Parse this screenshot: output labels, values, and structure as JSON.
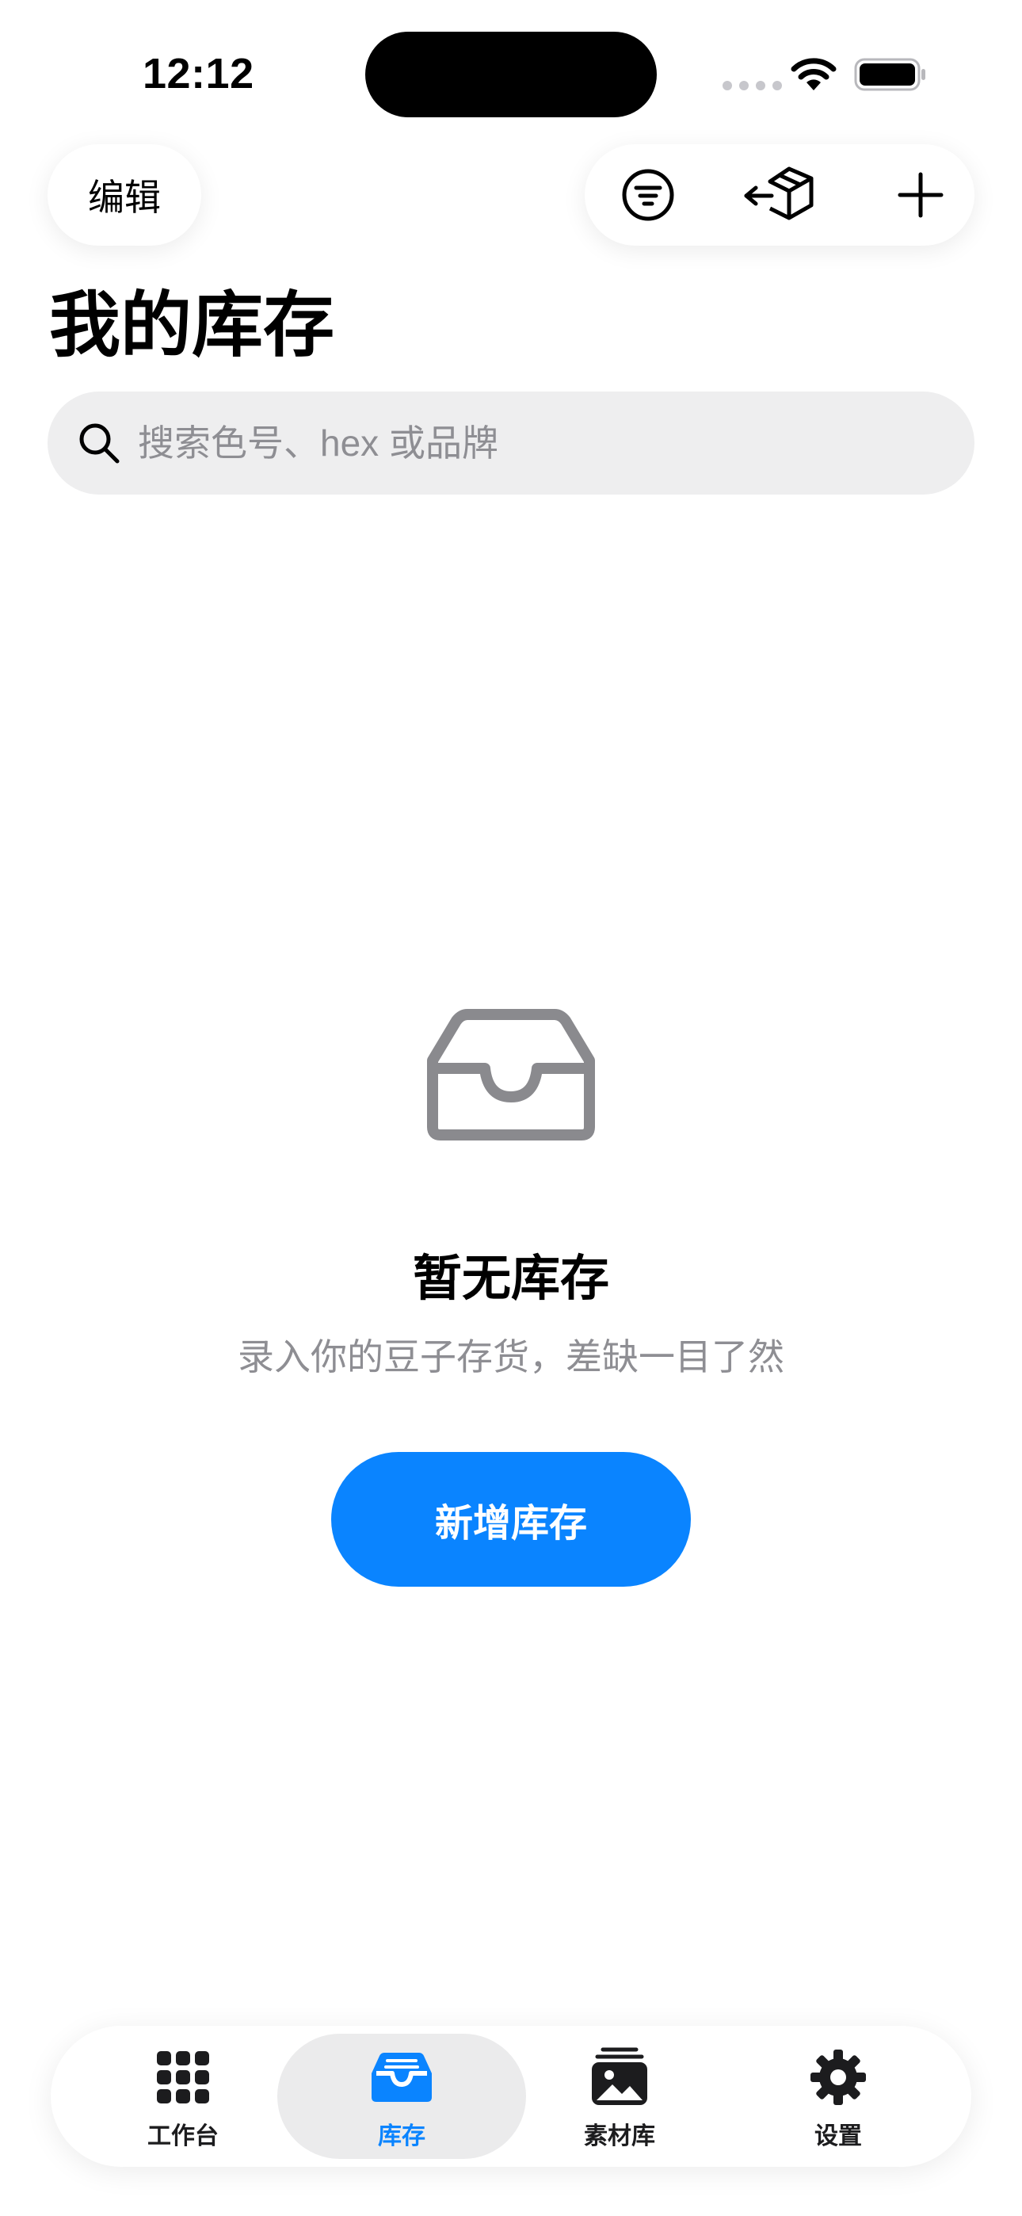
{
  "status_bar": {
    "time": "12:12"
  },
  "header": {
    "edit_label": "编辑",
    "icons": [
      "filter-icon",
      "box-transfer-icon",
      "plus-icon"
    ]
  },
  "page": {
    "title": "我的库存"
  },
  "search": {
    "placeholder": "搜索色号、hex 或品牌",
    "value": ""
  },
  "empty_state": {
    "icon": "tray-icon",
    "title": "暂无库存",
    "subtitle": "录入你的豆子存货，差缺一目了然",
    "button_label": "新增库存"
  },
  "tab_bar": {
    "items": [
      {
        "label": "工作台",
        "icon": "grid-icon",
        "active": false
      },
      {
        "label": "库存",
        "icon": "tray-icon",
        "active": true
      },
      {
        "label": "素材库",
        "icon": "photo-stack-icon",
        "active": false
      },
      {
        "label": "设置",
        "icon": "gear-icon",
        "active": false
      }
    ]
  },
  "colors": {
    "accent": "#0a84ff",
    "search_bg": "#eeeeef",
    "secondary_text": "#8e8e93",
    "tab_highlight": "#ebebec"
  }
}
